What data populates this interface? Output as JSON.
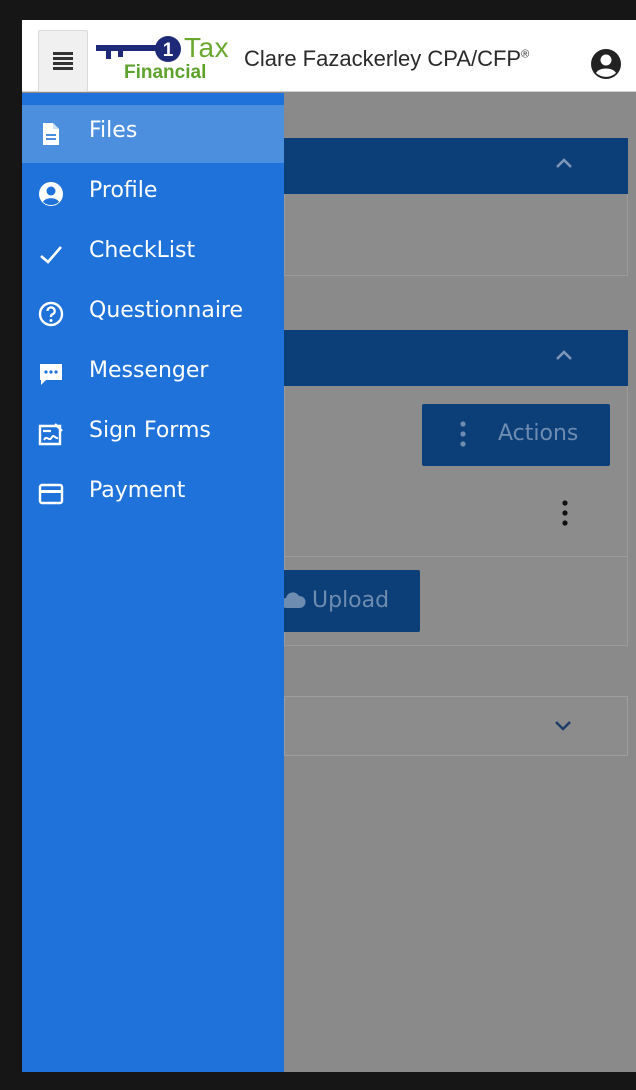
{
  "header": {
    "logo_word_tax": "Tax",
    "logo_word_financial": "Financial",
    "firm_name": "Clare Fazackerley CPA/CFP",
    "firm_name_mark": "®",
    "menu_icon": "hamburger-icon",
    "account_icon": "account-circle-icon"
  },
  "drawer": {
    "items": [
      {
        "label": "Files",
        "icon": "file-icon",
        "active": true
      },
      {
        "label": "Profile",
        "icon": "account-circle-icon",
        "active": false
      },
      {
        "label": "CheckList",
        "icon": "check-icon",
        "active": false
      },
      {
        "label": "Questionnaire",
        "icon": "question-circle-icon",
        "active": false
      },
      {
        "label": "Messenger",
        "icon": "chat-bubble-icon",
        "active": false
      },
      {
        "label": "Sign Forms",
        "icon": "sign-document-icon",
        "active": false
      },
      {
        "label": "Payment",
        "icon": "credit-card-icon",
        "active": false
      }
    ]
  },
  "content": {
    "actions_label": "Actions",
    "upload_label": "Upload"
  },
  "colors": {
    "drawer_bg": "#1e72d9",
    "drawer_active": "#4d8fdf",
    "card_header": "#0c3f78",
    "logo_green": "#6aa72f"
  }
}
